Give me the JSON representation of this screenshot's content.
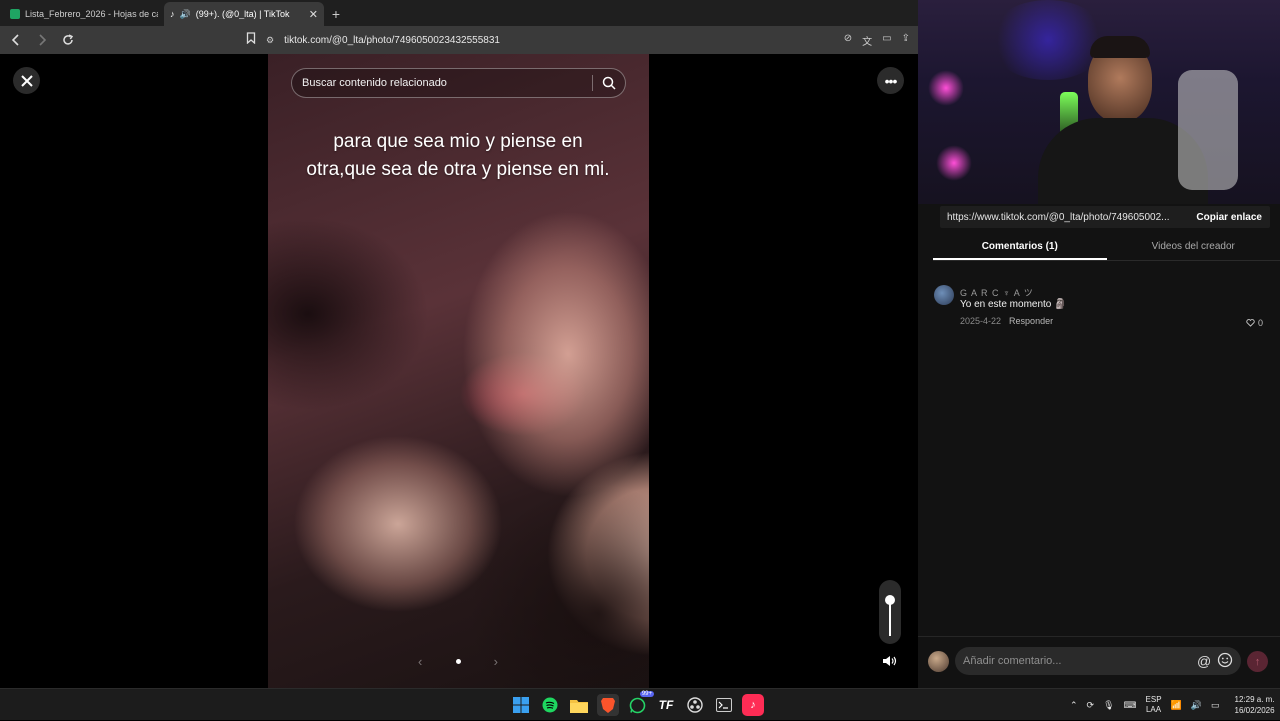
{
  "browser": {
    "tabs": [
      {
        "title": "Lista_Febrero_2026 - Hojas de cálculo",
        "favicon_color": "#1fa463"
      },
      {
        "title": "(99+). (@0_lta) | TikTok",
        "favicon_color": "#000000"
      }
    ],
    "url": "tiktok.com/@0_lta/photo/7496050023432555831"
  },
  "viewer": {
    "search_placeholder": "Buscar contenido relacionado",
    "caption": "para que sea mio y piense en otra,que sea de otra y piense en mi.",
    "close_icon": "close-icon",
    "more_icon": "more-icon",
    "volume_level": 0.85
  },
  "panel": {
    "share_link": "https://www.tiktok.com/@0_lta/photo/7496050023432555831",
    "share_link_display": "https://www.tiktok.com/@0_lta/photo/749605002...",
    "copy_label": "Copiar enlace",
    "tabs": [
      {
        "label": "Comentarios (1)",
        "active": true
      },
      {
        "label": "Videos del creador",
        "active": false
      }
    ],
    "comments": [
      {
        "user": "G A R C ♆ A ツ",
        "text": "Yo en este momento 🗿",
        "date": "2025-4-22",
        "reply_label": "Responder",
        "likes": "0"
      }
    ],
    "compose_placeholder": "Añadir comentario..."
  },
  "taskbar": {
    "apps": [
      "windows-start",
      "spotify",
      "file-explorer",
      "brave",
      "whatsapp",
      "tf-app",
      "obs",
      "terminal",
      "tiktok"
    ],
    "whatsapp_badge": "99+",
    "lang": "ESP",
    "lang_sub": "LAA",
    "time": "12:29 a. m.",
    "date": "16/02/2026"
  },
  "colors": {
    "accent": "#fe2c55",
    "panel_bg": "#121212"
  }
}
